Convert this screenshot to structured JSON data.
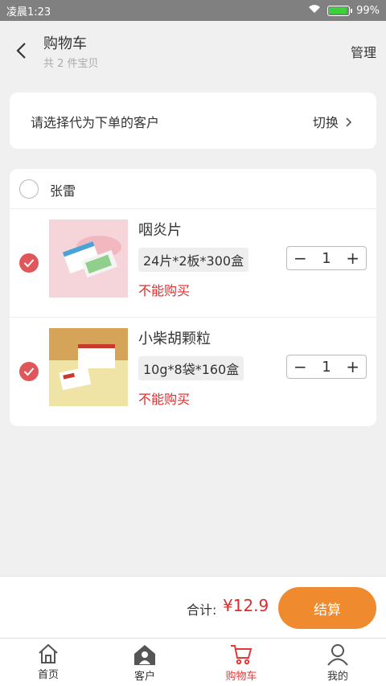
{
  "status_bar": {
    "time": "凌晨1:23",
    "battery": "99%"
  },
  "header": {
    "title": "购物车",
    "subtitle": "共 2 件宝贝",
    "manage": "管理"
  },
  "customer_select": {
    "prompt": "请选择代为下单的客户",
    "switch": "切换"
  },
  "cart": {
    "customer_name": "张雷",
    "items": [
      {
        "name": "咽炎片",
        "spec": "24片*2板*300盒",
        "warning": "不能购买",
        "quantity": "1"
      },
      {
        "name": "小柴胡颗粒",
        "spec": "10g*8袋*160盒",
        "warning": "不能购买",
        "quantity": "1"
      }
    ]
  },
  "footer": {
    "total_label": "合计:",
    "total_value": "¥12.9",
    "checkout": "结算"
  },
  "tabs": [
    {
      "label": "首页",
      "icon": "home-icon"
    },
    {
      "label": "客户",
      "icon": "customer-icon"
    },
    {
      "label": "购物车",
      "icon": "cart-icon",
      "active": true
    },
    {
      "label": "我的",
      "icon": "profile-icon"
    }
  ],
  "colors": {
    "accent": "#f08a2f",
    "price": "#e02b2b",
    "check": "#e0575b",
    "active_tab": "#e53935"
  }
}
